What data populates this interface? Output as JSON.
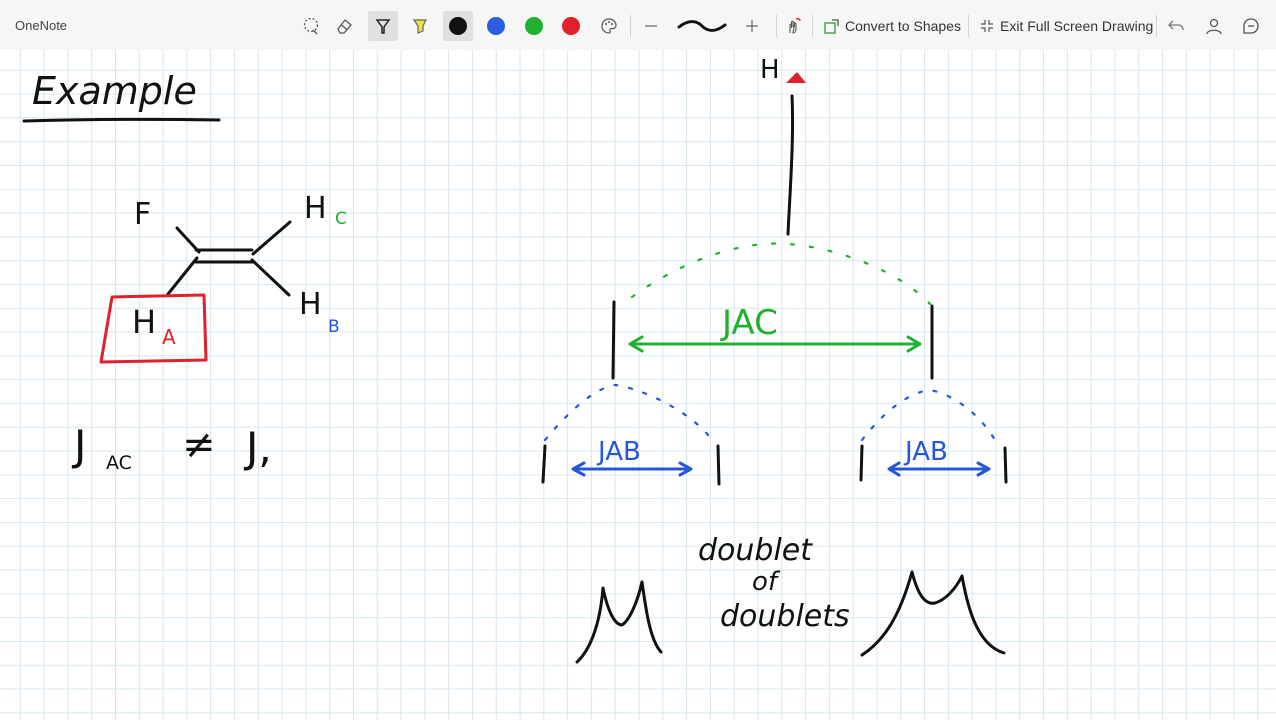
{
  "app": {
    "title": "OneNote"
  },
  "toolbar": {
    "convert_label": "Convert to Shapes",
    "exit_label": "Exit Full Screen Drawing",
    "colors": {
      "black": "#111111",
      "blue": "#2b5fe0",
      "green": "#20b030",
      "red": "#e0202a"
    }
  },
  "ink": {
    "example": "Example",
    "atom_f": "F",
    "atom_h": "H",
    "sub_a": "A",
    "sub_b": "B",
    "sub_c": "C",
    "j_letter": "J",
    "j_sub_ac": "AC",
    "neq": "≠",
    "j_right_tail": "J,",
    "label_jac": "JAC",
    "label_jab": "JAB",
    "dd_line1": "doublet",
    "dd_line2": "of",
    "dd_line3": "doublets",
    "colors": {
      "black": "#111111",
      "red": "#e0202a",
      "green": "#1fb02f",
      "blue": "#2557d8"
    }
  }
}
